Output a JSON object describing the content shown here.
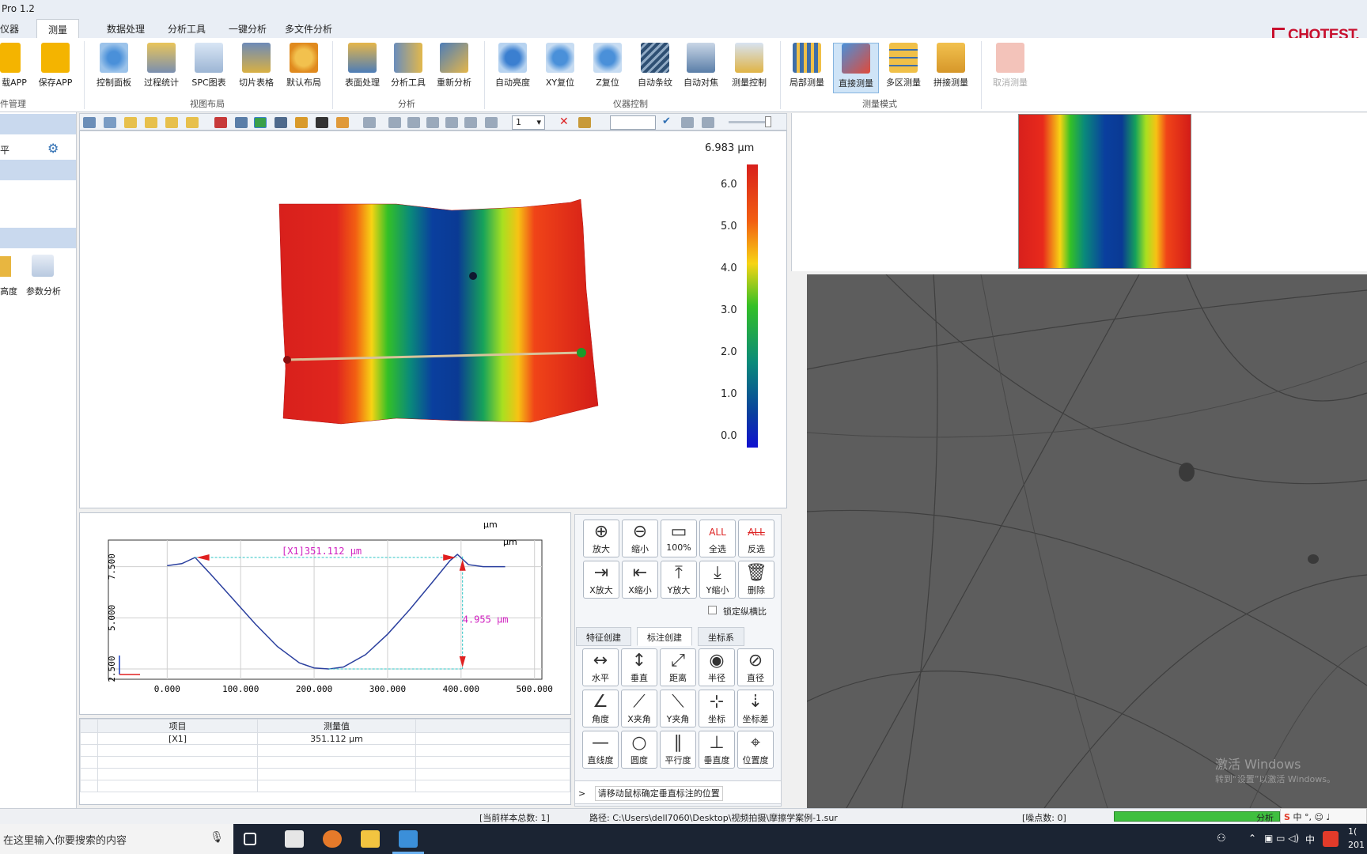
{
  "window": {
    "title": "Pro 1.2"
  },
  "tabs": [
    "仪器",
    "测量",
    "数据处理",
    "分析工具",
    "一键分析",
    "多文件分析"
  ],
  "active_tab": "测量",
  "brand": "CHOTEST.",
  "ribbon": {
    "buttons": [
      {
        "label": "载APP",
        "icon": "load-app-icon"
      },
      {
        "label": "保存APP",
        "icon": "save-app-icon"
      },
      {
        "label": "控制面板",
        "icon": "control-panel-icon"
      },
      {
        "label": "过程统计",
        "icon": "process-stats-icon"
      },
      {
        "label": "SPC图表",
        "icon": "spc-chart-icon"
      },
      {
        "label": "切片表格",
        "icon": "slice-table-icon"
      },
      {
        "label": "默认布局",
        "icon": "default-layout-icon"
      },
      {
        "label": "表面处理",
        "icon": "surface-treatment-icon"
      },
      {
        "label": "分析工具",
        "icon": "analysis-tools-icon"
      },
      {
        "label": "重新分析",
        "icon": "reanalyze-icon"
      },
      {
        "label": "自动亮度",
        "icon": "auto-brightness-icon"
      },
      {
        "label": "XY复位",
        "icon": "xy-reset-icon"
      },
      {
        "label": "Z复位",
        "icon": "z-reset-icon"
      },
      {
        "label": "自动条纹",
        "icon": "auto-fringe-icon"
      },
      {
        "label": "自动对焦",
        "icon": "autofocus-icon"
      },
      {
        "label": "测量控制",
        "icon": "measure-control-icon"
      },
      {
        "label": "局部测量",
        "icon": "local-measure-icon"
      },
      {
        "label": "直接测量",
        "icon": "direct-measure-icon"
      },
      {
        "label": "多区测量",
        "icon": "multi-area-measure-icon"
      },
      {
        "label": "拼接测量",
        "icon": "stitch-measure-icon"
      },
      {
        "label": "取消测量",
        "icon": "cancel-measure-icon"
      }
    ],
    "groups": [
      "件管理",
      "视图布局",
      "分析",
      "仪器控制",
      "测量模式"
    ]
  },
  "left_panel": {
    "item1": "平",
    "item2": "高度",
    "item3": "参数分析"
  },
  "toolbar2": {
    "layer_select": "1"
  },
  "colorbar": {
    "max_label": "6.983 µm",
    "ticks": [
      "6.0",
      "5.0",
      "4.0",
      "3.0",
      "2.0",
      "1.0",
      "0.0"
    ]
  },
  "chart_data": {
    "type": "line",
    "xlabel": "",
    "ylabel": "",
    "unit_x": "µm",
    "unit_y": "µm",
    "xlim": [
      -80,
      510
    ],
    "ylim": [
      2.0,
      8.8
    ],
    "x_ticks": [
      "0.000",
      "100.000",
      "200.000",
      "300.000",
      "400.000",
      "500.000"
    ],
    "y_ticks": [
      "2.500",
      "5.000",
      "7.500"
    ],
    "series": [
      {
        "x": [
          0,
          20,
          38,
          60,
          90,
          120,
          150,
          180,
          200,
          220,
          240,
          270,
          300,
          330,
          360,
          385,
          395,
          410,
          430,
          460
        ],
        "values": [
          7.55,
          7.65,
          7.95,
          7.1,
          5.9,
          4.7,
          3.6,
          2.8,
          2.55,
          2.5,
          2.6,
          3.2,
          4.2,
          5.4,
          6.7,
          7.8,
          8.1,
          7.6,
          7.5,
          7.5
        ]
      }
    ],
    "annotations": [
      {
        "text": "[X1]351.112 μm"
      },
      {
        "text": "4.955 μm"
      }
    ]
  },
  "results_table": {
    "headers": [
      "项目",
      "测量值"
    ],
    "rows": [
      [
        "[X1]",
        "351.112 µm"
      ]
    ]
  },
  "tool_palette": {
    "view_buttons": [
      "放大",
      "缩小",
      "100%",
      "全选",
      "反选",
      "X放大",
      "X缩小",
      "Y放大",
      "Y缩小",
      "删除"
    ],
    "lock_ratio_label": "锁定纵横比",
    "subtabs": [
      "特征创建",
      "标注创建",
      "坐标系"
    ],
    "active_subtab": "标注创建",
    "annotation_buttons": [
      "水平",
      "垂直",
      "距离",
      "半径",
      "直径",
      "角度",
      "X夹角",
      "Y夹角",
      "坐标",
      "坐标差",
      "直线度",
      "圆度",
      "平行度",
      "垂直度",
      "位置度"
    ],
    "hint": "请移动鼠标确定垂直标注的位置"
  },
  "watermark": {
    "line1": "激活 Windows",
    "line2": "转到“设置”以激活 Windows。"
  },
  "status": {
    "sample_count": "[当前样本总数: 1]",
    "path": "路径: C:\\Users\\dell7060\\Desktop\\视频拍摄\\摩擦学案例-1.sur",
    "noise": "[噪点数: 0]",
    "analysis": "分析"
  },
  "taskbar": {
    "search_placeholder": "在这里输入你要搜索的内容",
    "ime": "中",
    "lang": "中",
    "time": "1(",
    "date": "201"
  }
}
